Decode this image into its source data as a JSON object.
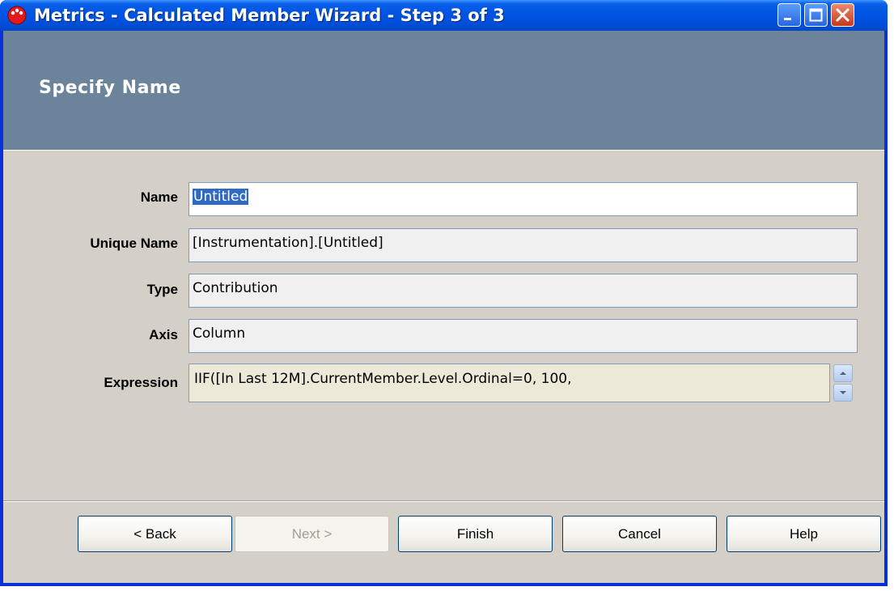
{
  "window": {
    "title": "Metrics - Calculated Member Wizard - Step 3 of 3",
    "icon": "app-logo-icon",
    "controls": [
      "minimize-icon",
      "maximize-icon",
      "close-icon"
    ]
  },
  "header": {
    "title": "Specify Name"
  },
  "form": {
    "name_label": "Name",
    "name_value": "Untitled",
    "unique_name_label": "Unique Name",
    "unique_name_value": "[Instrumentation].[Untitled]",
    "type_label": "Type",
    "type_value": "Contribution",
    "axis_label": "Axis",
    "axis_value": "Column",
    "expression_label": "Expression",
    "expression_value": "IIF([In Last 12M].CurrentMember.Level.Ordinal=0, 100,"
  },
  "buttons": {
    "back": "< Back",
    "next": "Next >",
    "finish": "Finish",
    "cancel": "Cancel",
    "help": "Help"
  },
  "colors": {
    "titlebar": "#0054e3",
    "header_band": "#6c839c",
    "body": "#d4d0c8",
    "selection": "#316ac5"
  }
}
